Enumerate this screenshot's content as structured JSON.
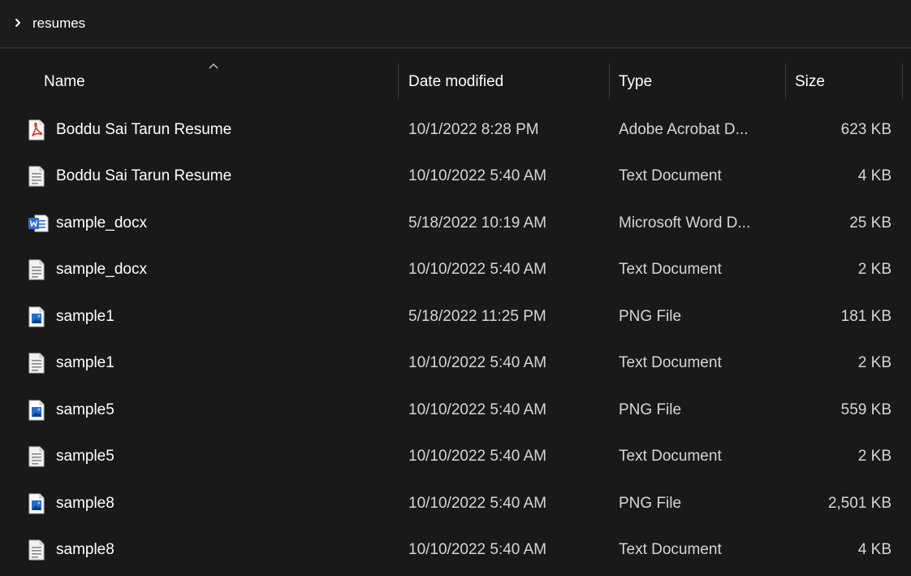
{
  "breadcrumb": {
    "path": "resumes"
  },
  "columns": {
    "name": "Name",
    "date": "Date modified",
    "type": "Type",
    "size": "Size"
  },
  "colors": {
    "background": "#191919",
    "text": "#ffffff",
    "text_secondary": "#d6d6d6",
    "pdf_red": "#e0301e",
    "word_blue": "#2b6fd6",
    "image_blue": "#1f6fd1"
  },
  "files": [
    {
      "name": "Boddu Sai Tarun Resume",
      "date": "10/1/2022 8:28 PM",
      "type": "Adobe Acrobat D...",
      "size": "623 KB",
      "icon": "pdf-icon"
    },
    {
      "name": "Boddu Sai Tarun Resume",
      "date": "10/10/2022 5:40 AM",
      "type": "Text Document",
      "size": "4 KB",
      "icon": "text-file-icon"
    },
    {
      "name": "sample_docx",
      "date": "5/18/2022 10:19 AM",
      "type": "Microsoft Word D...",
      "size": "25 KB",
      "icon": "word-icon"
    },
    {
      "name": "sample_docx",
      "date": "10/10/2022 5:40 AM",
      "type": "Text Document",
      "size": "2 KB",
      "icon": "text-file-icon"
    },
    {
      "name": "sample1",
      "date": "5/18/2022 11:25 PM",
      "type": "PNG File",
      "size": "181 KB",
      "icon": "image-file-icon"
    },
    {
      "name": "sample1",
      "date": "10/10/2022 5:40 AM",
      "type": "Text Document",
      "size": "2 KB",
      "icon": "text-file-icon"
    },
    {
      "name": "sample5",
      "date": "10/10/2022 5:40 AM",
      "type": "PNG File",
      "size": "559 KB",
      "icon": "image-file-icon"
    },
    {
      "name": "sample5",
      "date": "10/10/2022 5:40 AM",
      "type": "Text Document",
      "size": "2 KB",
      "icon": "text-file-icon"
    },
    {
      "name": "sample8",
      "date": "10/10/2022 5:40 AM",
      "type": "PNG File",
      "size": "2,501 KB",
      "icon": "image-file-icon"
    },
    {
      "name": "sample8",
      "date": "10/10/2022 5:40 AM",
      "type": "Text Document",
      "size": "4 KB",
      "icon": "text-file-icon"
    }
  ]
}
